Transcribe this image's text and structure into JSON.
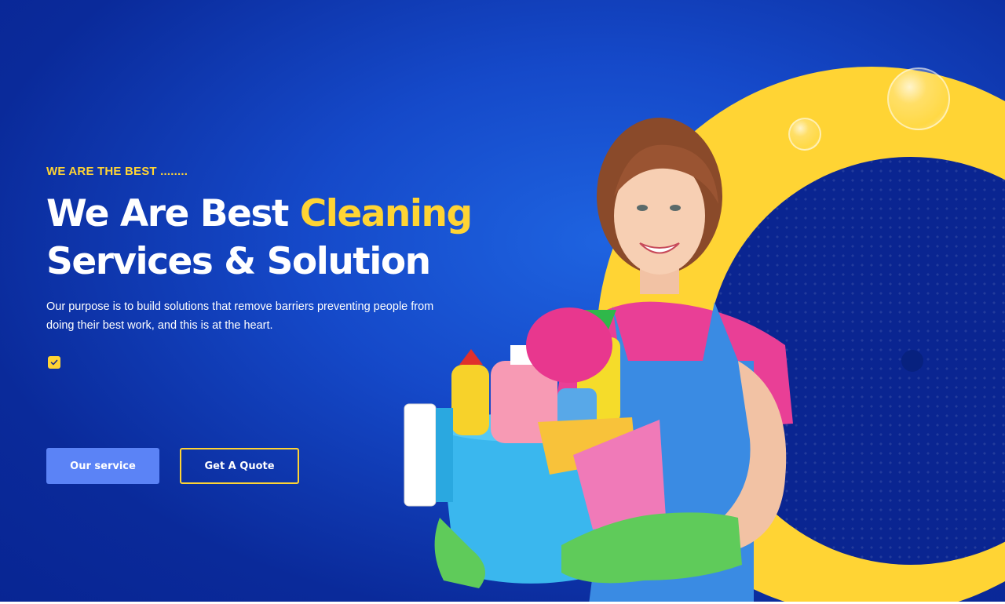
{
  "hero": {
    "eyebrow": "WE ARE THE BEST ........",
    "headline_part1": "We Are Best ",
    "headline_accent": "Cleaning",
    "headline_part2": "Services & Solution",
    "description": "Our purpose is to build solutions that remove barriers preventing people from doing their best work, and this is at the heart.",
    "checkbox_icon": "check-icon",
    "buttons": {
      "primary_label": "Our service",
      "secondary_label": "Get A Quote"
    }
  },
  "colors": {
    "background": "#1549c9",
    "accent_yellow": "#ffd434",
    "primary_button": "#5b83f6",
    "dark_navy": "#0a2591"
  },
  "illustration": {
    "subject": "cleaning-woman-with-bucket-illustration"
  }
}
